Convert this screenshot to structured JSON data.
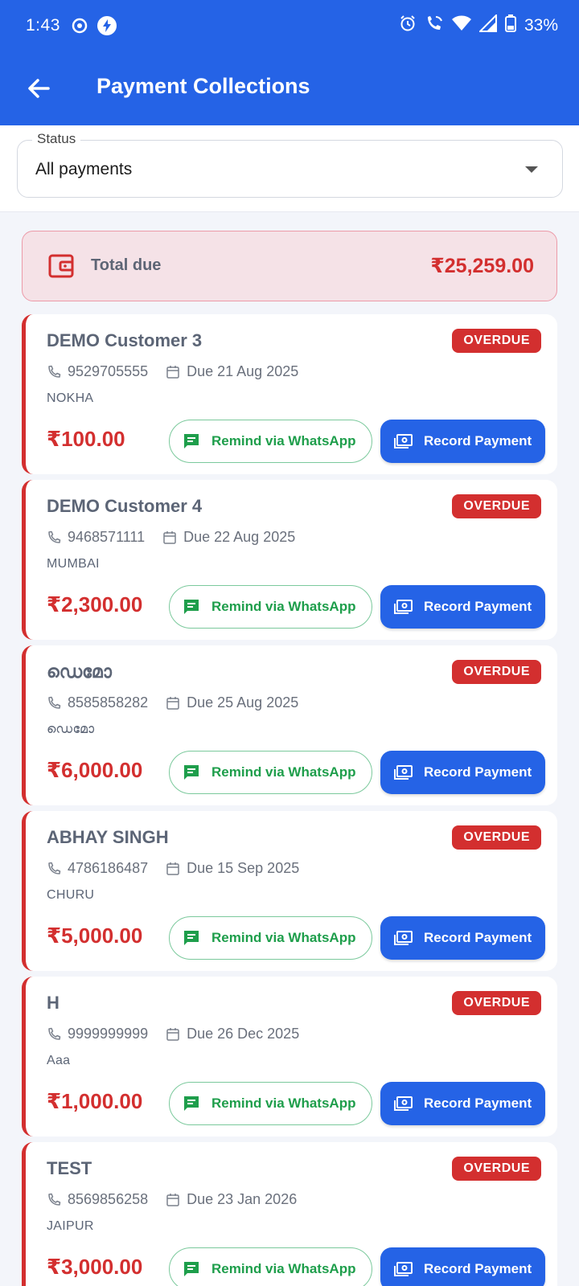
{
  "status_bar": {
    "time": "1:43",
    "battery": "33%"
  },
  "app_bar": {
    "title": "Payment Collections"
  },
  "filter": {
    "label": "Status",
    "value": "All payments"
  },
  "total": {
    "label": "Total due",
    "amount": "₹25,259.00"
  },
  "actions": {
    "remind_label": "Remind via WhatsApp",
    "record_label": "Record Payment"
  },
  "colors": {
    "primary": "#2563e6",
    "overdue": "#d32f2f",
    "whatsapp": "#1e9e4b"
  },
  "customers": [
    {
      "name": "DEMO Customer 3",
      "status": "OVERDUE",
      "phone": "9529705555",
      "due": "Due 21 Aug 2025",
      "city": "NOKHA",
      "amount": "₹100.00"
    },
    {
      "name": "DEMO Customer 4",
      "status": "OVERDUE",
      "phone": "9468571111",
      "due": "Due 22 Aug 2025",
      "city": "MUMBAI",
      "amount": "₹2,300.00"
    },
    {
      "name": "ഡെമോ",
      "status": "OVERDUE",
      "phone": "8585858282",
      "due": "Due 25 Aug 2025",
      "city": "ഡെമോ",
      "amount": "₹6,000.00"
    },
    {
      "name": "ABHAY SINGH",
      "status": "OVERDUE",
      "phone": "4786186487",
      "due": "Due 15 Sep 2025",
      "city": "CHURU",
      "amount": "₹5,000.00"
    },
    {
      "name": "H",
      "status": "OVERDUE",
      "phone": "9999999999",
      "due": "Due 26 Dec 2025",
      "city": "Aaa",
      "amount": "₹1,000.00"
    },
    {
      "name": "TEST",
      "status": "OVERDUE",
      "phone": "8569856258",
      "due": "Due 23 Jan 2026",
      "city": "JAIPUR",
      "amount": "₹3,000.00"
    }
  ]
}
